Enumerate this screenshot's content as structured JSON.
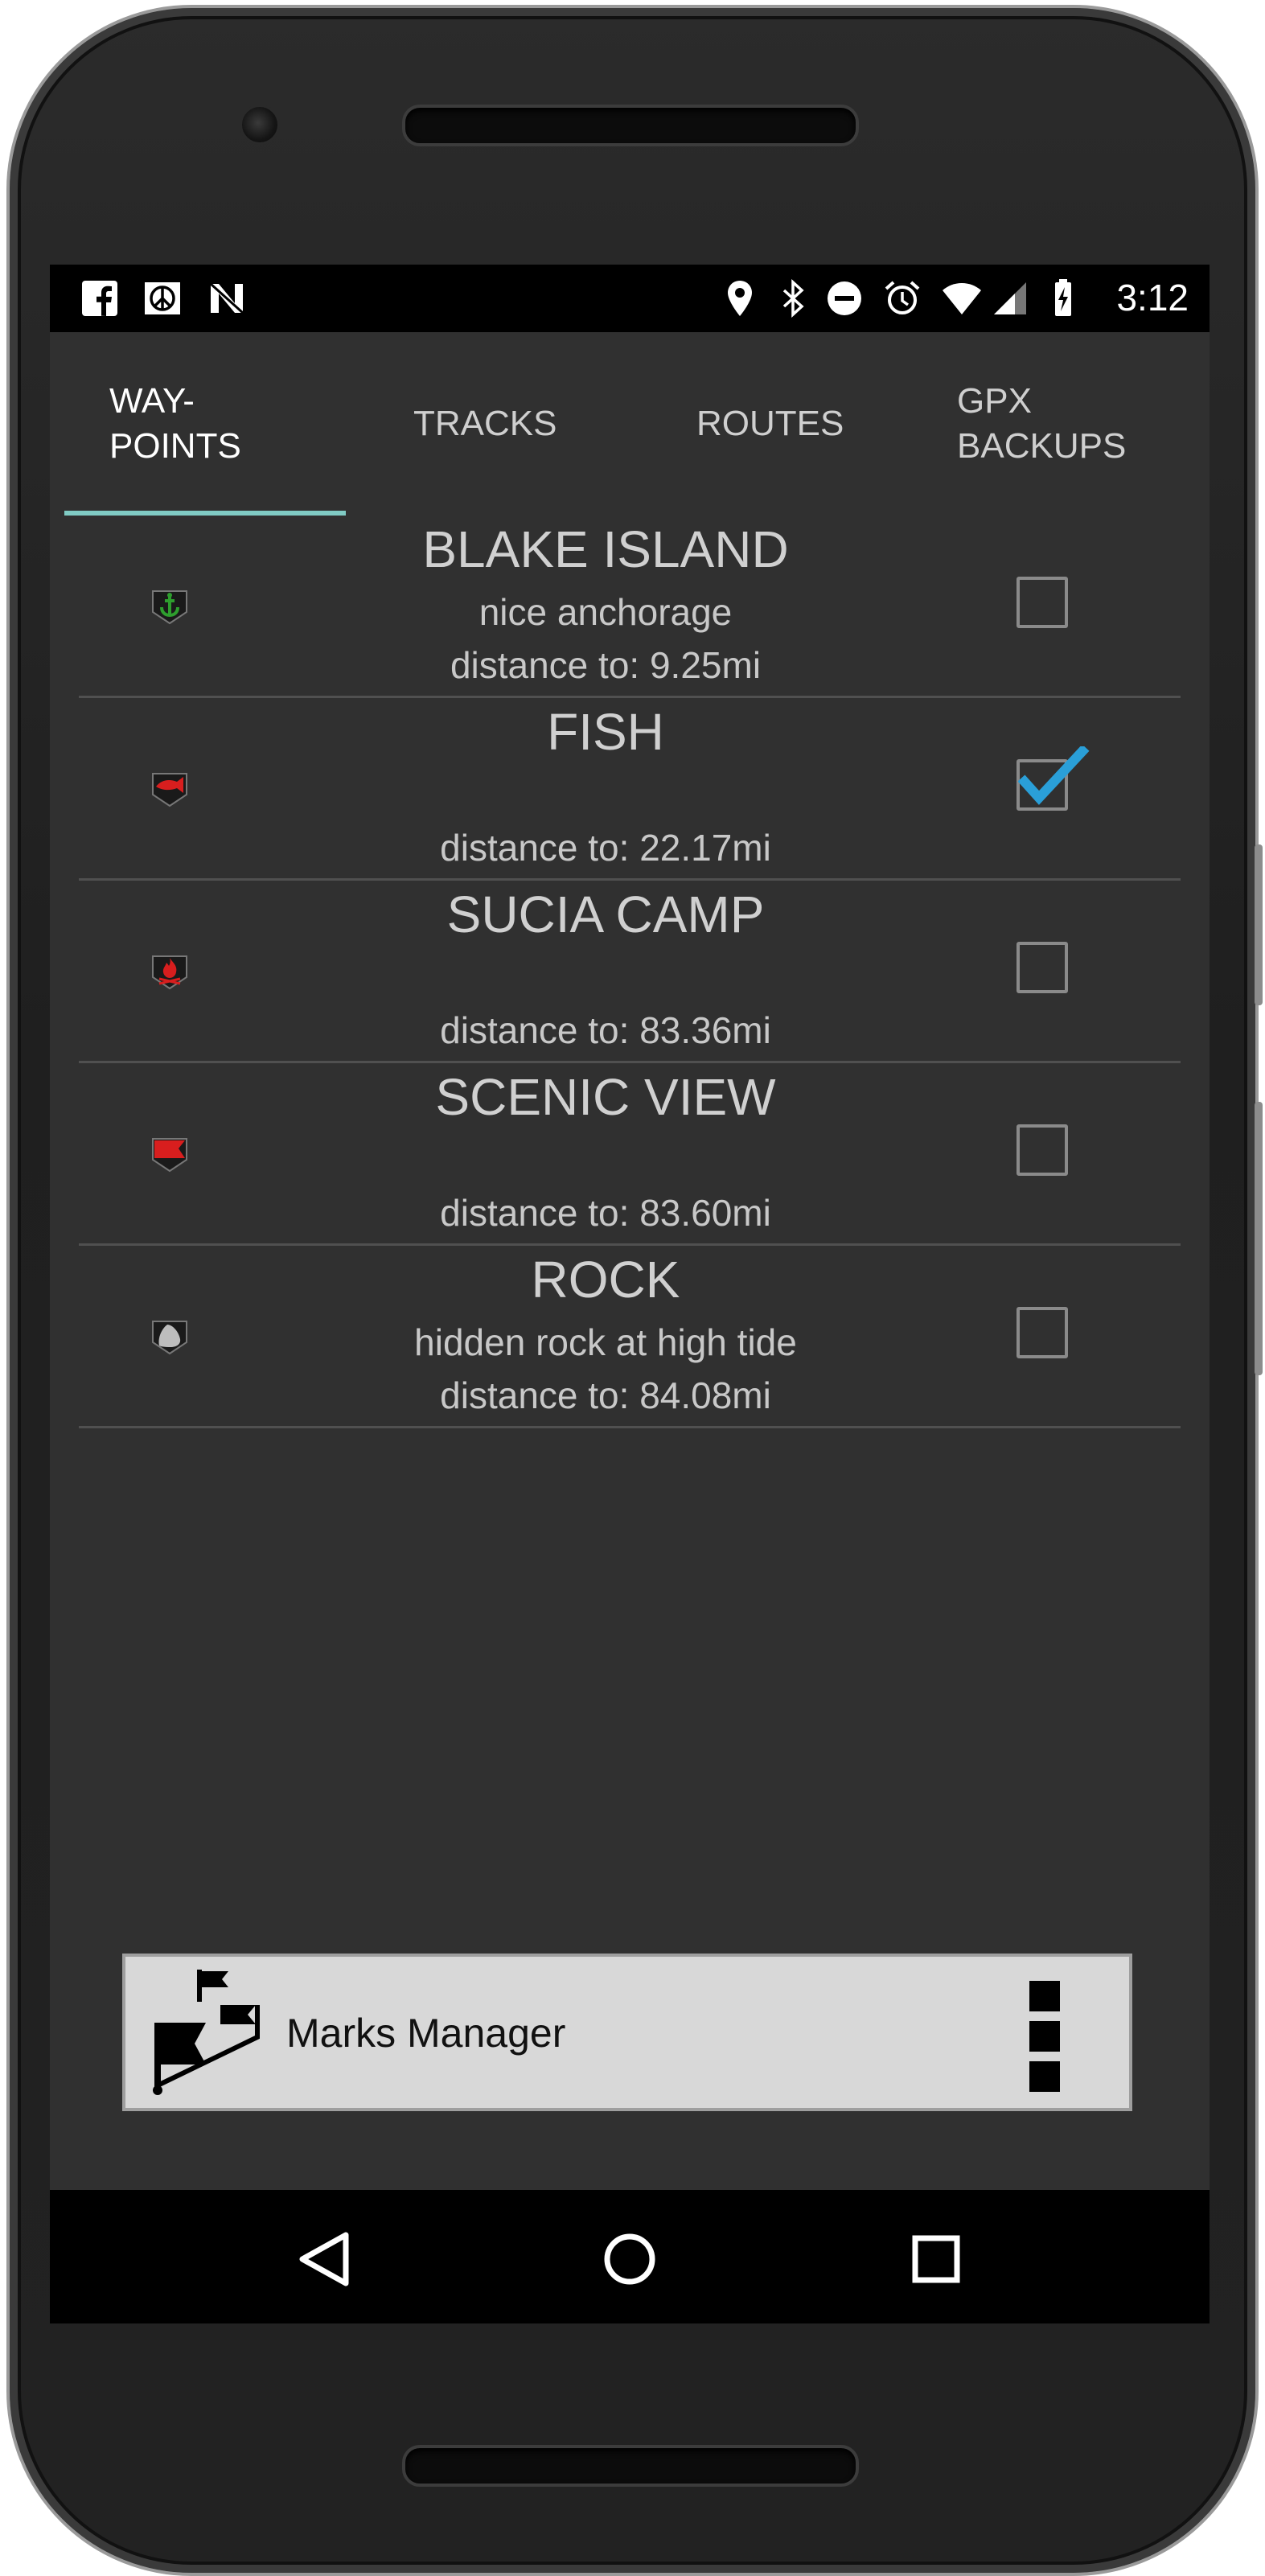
{
  "status_bar": {
    "time": "3:12",
    "left_icons": [
      "facebook-icon",
      "peace-icon",
      "n-app-icon"
    ],
    "right_icons": [
      "location-icon",
      "bluetooth-icon",
      "do-not-disturb-icon",
      "alarm-icon",
      "wifi-icon",
      "cell-signal-icon",
      "battery-charging-icon"
    ]
  },
  "tabs": [
    {
      "line1": "WAY-",
      "line2": "POINTS",
      "active": true
    },
    {
      "line1": "TRACKS",
      "line2": "",
      "active": false
    },
    {
      "line1": "ROUTES",
      "line2": "",
      "active": false
    },
    {
      "line1": "GPX",
      "line2": "BACKUPS",
      "active": false
    }
  ],
  "waypoints": [
    {
      "title": "BLAKE ISLAND",
      "description": "nice anchorage",
      "distance": "distance to: 9.25mi",
      "checked": false,
      "icon": "anchor-icon",
      "icon_color": "#2e9e2e"
    },
    {
      "title": "FISH",
      "description": "",
      "distance": "distance to: 22.17mi",
      "checked": true,
      "icon": "fish-icon",
      "icon_color": "#d81e1e"
    },
    {
      "title": "SUCIA CAMP",
      "description": "",
      "distance": "distance to: 83.36mi",
      "checked": false,
      "icon": "campfire-icon",
      "icon_color": "#d81e1e"
    },
    {
      "title": "SCENIC VIEW",
      "description": "",
      "distance": "distance to: 83.60mi",
      "checked": false,
      "icon": "flag-icon",
      "icon_color": "#d81e1e"
    },
    {
      "title": "ROCK",
      "description": "hidden rock at high tide",
      "distance": "distance to: 84.08mi",
      "checked": false,
      "icon": "rock-icon",
      "icon_color": "#bdbdbd"
    }
  ],
  "bottom_bar": {
    "title": "Marks Manager",
    "icon": "flags-icon",
    "menu_icon": "overflow-menu-icon"
  },
  "nav_bar": {
    "icons": [
      "back-icon",
      "home-icon",
      "recents-icon"
    ]
  },
  "colors": {
    "background": "#303030",
    "tab_indicator": "#80cbc4",
    "check_accent": "#2a9fd8"
  }
}
